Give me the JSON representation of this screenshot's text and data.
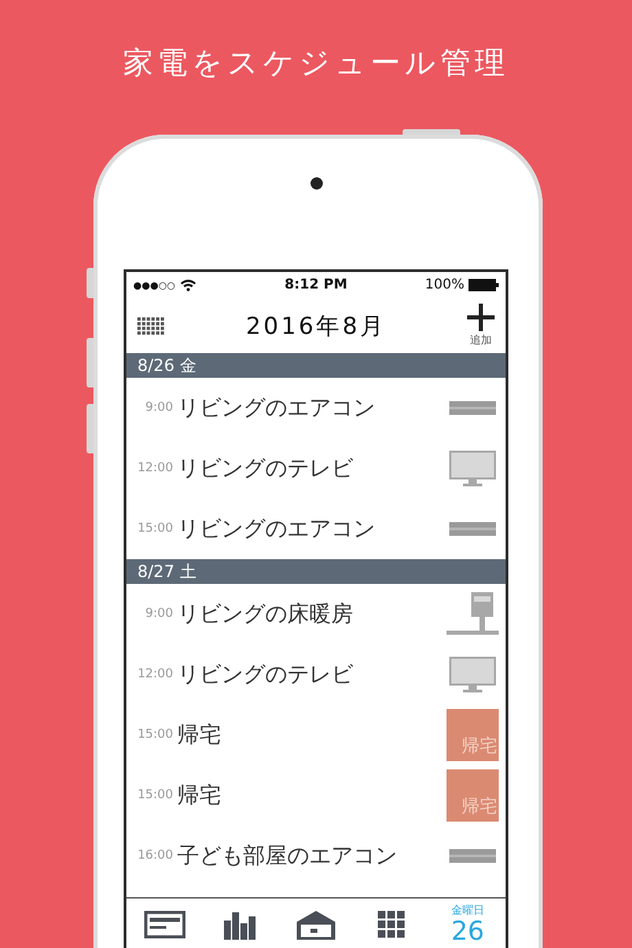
{
  "headline": "家電をスケジュール管理",
  "status_bar": {
    "carrier_dots": "●●●○○",
    "time": "8:12 PM",
    "battery": "100%"
  },
  "header": {
    "title": "2016年8月",
    "add_label": "追加"
  },
  "sections": [
    {
      "date": "8/26",
      "weekday": "金",
      "rows": [
        {
          "time": "9:00",
          "title": "リビングのエアコン",
          "kind": "aircon"
        },
        {
          "time": "12:00",
          "title": "リビングのテレビ",
          "kind": "tv"
        },
        {
          "time": "15:00",
          "title": "リビングのエアコン",
          "kind": "aircon"
        }
      ]
    },
    {
      "date": "8/27",
      "weekday": "土",
      "rows": [
        {
          "time": "9:00",
          "title": "リビングの床暖房",
          "kind": "floor_heating"
        },
        {
          "time": "12:00",
          "title": "リビングのテレビ",
          "kind": "tv"
        },
        {
          "time": "15:00",
          "title": "帰宅",
          "kind": "homecoming",
          "badge": "帰宅"
        },
        {
          "time": "15:00",
          "title": "帰宅",
          "kind": "homecoming",
          "badge": "帰宅"
        },
        {
          "time": "16:00",
          "title": "子ども部屋のエアコン",
          "kind": "aircon"
        }
      ]
    }
  ],
  "tabs": [
    {
      "kind": "card",
      "selected": false
    },
    {
      "kind": "chart",
      "selected": false
    },
    {
      "kind": "house",
      "selected": false
    },
    {
      "kind": "grid",
      "selected": false
    },
    {
      "kind": "date",
      "weekday": "金曜日",
      "day": "26",
      "selected": true
    }
  ]
}
